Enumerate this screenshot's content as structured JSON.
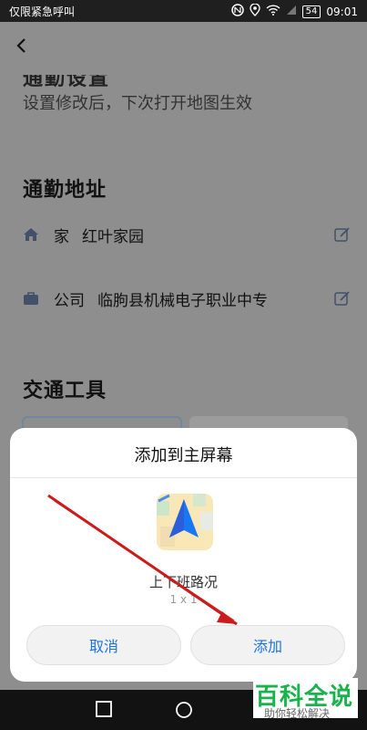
{
  "status_bar": {
    "carrier": "仅限紧急呼叫",
    "battery": "54",
    "time": "09:01"
  },
  "header": {
    "title_partial": "通勤设置",
    "subtitle": "设置修改后，下次打开地图生效"
  },
  "commute": {
    "section_title": "通勤地址",
    "home_label": "家",
    "home_value": "红叶家园",
    "company_label": "公司",
    "company_value": "临朐县机械电子职业中专"
  },
  "transport": {
    "section_title": "交通工具"
  },
  "dialog": {
    "title": "添加到主屏幕",
    "app_name": "上下班路况",
    "app_size": "1 x 1",
    "cancel_label": "取消",
    "add_label": "添加"
  },
  "watermark": {
    "title": "百科全说",
    "subtitle": "助你轻松解决"
  },
  "colors": {
    "accent": "#1a73e8",
    "annotation_arrow": "#cc1b1b"
  }
}
